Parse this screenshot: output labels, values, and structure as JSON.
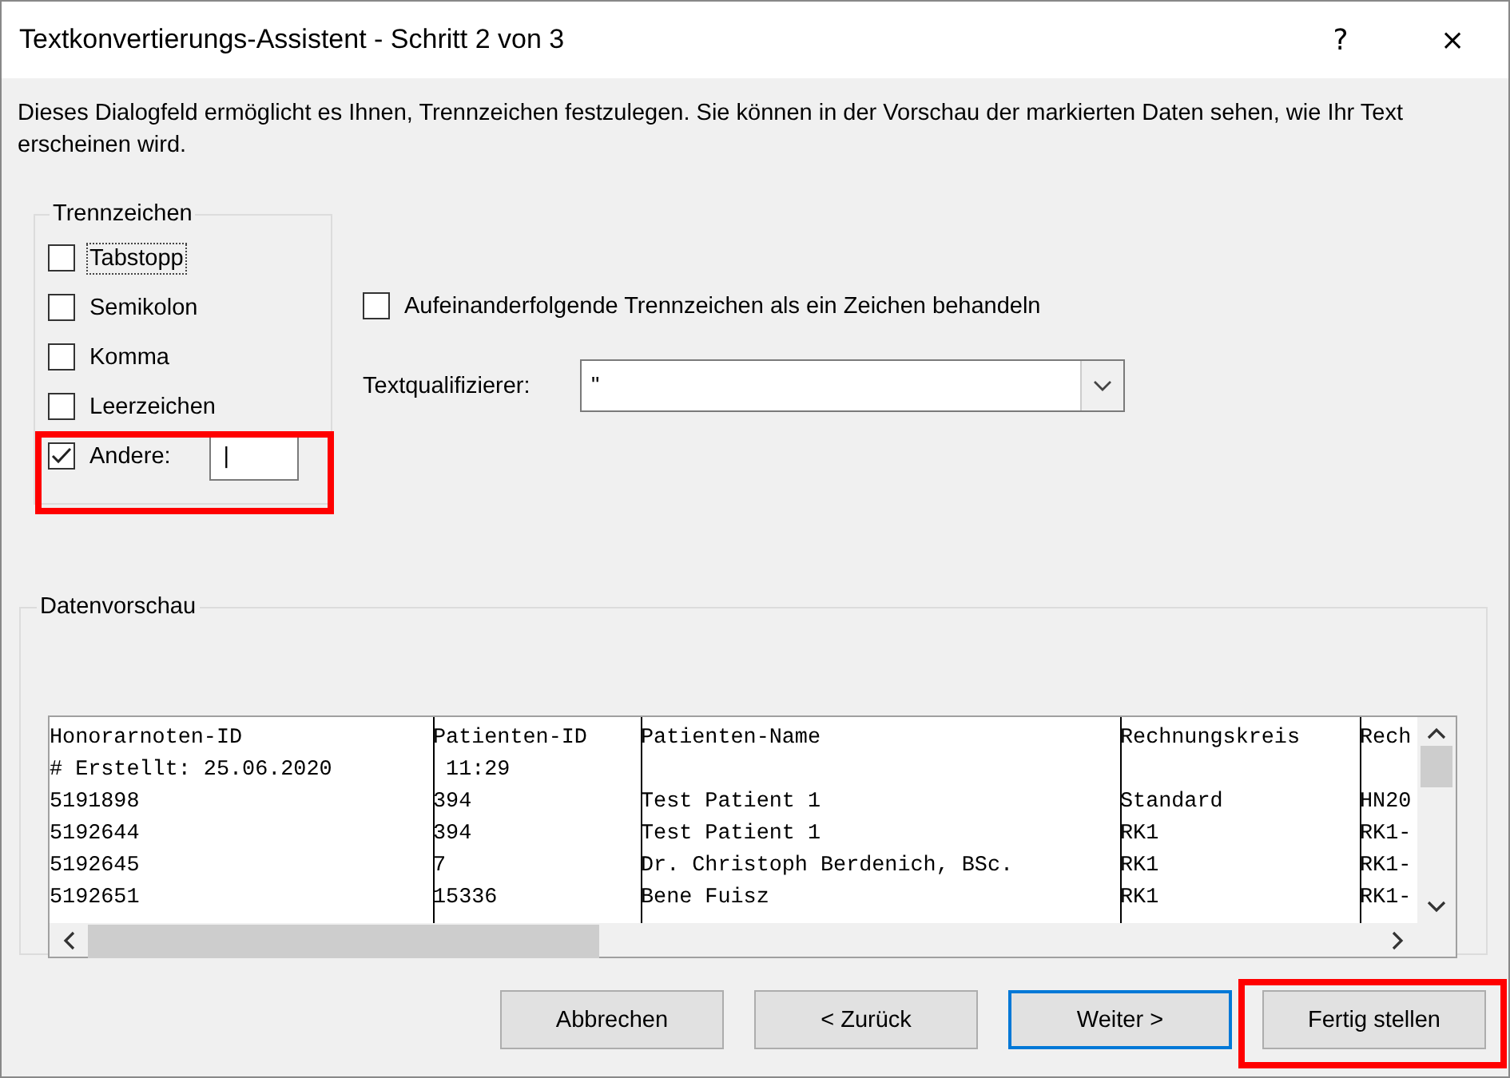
{
  "window": {
    "title": "Textkonvertierungs-Assistent - Schritt 2 von 3",
    "help": "?",
    "close": "×"
  },
  "description": "Dieses Dialogfeld ermöglicht es Ihnen, Trennzeichen festzulegen. Sie können in der Vorschau der markierten Daten sehen, wie Ihr Text erscheinen wird.",
  "delimiters": {
    "title": "Trennzeichen",
    "items": [
      {
        "label": "Tabstopp",
        "checked": false,
        "focused": true,
        "highlighted": false
      },
      {
        "label": "Semikolon",
        "checked": false,
        "focused": false,
        "highlighted": false
      },
      {
        "label": "Komma",
        "checked": false,
        "focused": false,
        "highlighted": false
      },
      {
        "label": "Leerzeichen",
        "checked": false,
        "focused": false,
        "highlighted": false
      },
      {
        "label": "Andere:",
        "checked": true,
        "focused": false,
        "highlighted": true,
        "value": "|"
      }
    ]
  },
  "consecutive": {
    "label": "Aufeinanderfolgende Trennzeichen als ein Zeichen behandeln",
    "checked": false
  },
  "qualifier": {
    "label": "Textqualifizierer:",
    "value": "\""
  },
  "preview": {
    "title": "Datenvorschau",
    "rows": [
      [
        "Honorarnoten-ID",
        "Patienten-ID",
        "Patienten-Name",
        "Rechnungskreis",
        "Rech"
      ],
      [
        "# Erstellt: 25.06.2020",
        " 11:29",
        "",
        "",
        ""
      ],
      [
        "5191898",
        "394",
        "Test Patient 1",
        "Standard",
        "HN20"
      ],
      [
        "5192644",
        "394",
        "Test Patient 1",
        "RK1",
        "RK1-"
      ],
      [
        "5192645",
        "7",
        "Dr. Christoph Berdenich, BSc.",
        "RK1",
        "RK1-"
      ],
      [
        "5192651",
        "15336",
        "Bene Fuisz",
        "RK1",
        "RK1-"
      ]
    ]
  },
  "buttons": [
    {
      "label": "Abbrechen",
      "default": false,
      "highlighted": false
    },
    {
      "label": "< Zurück",
      "default": false,
      "highlighted": false
    },
    {
      "label": "Weiter >",
      "default": true,
      "highlighted": false
    },
    {
      "label": "Fertig stellen",
      "default": false,
      "highlighted": true
    }
  ]
}
